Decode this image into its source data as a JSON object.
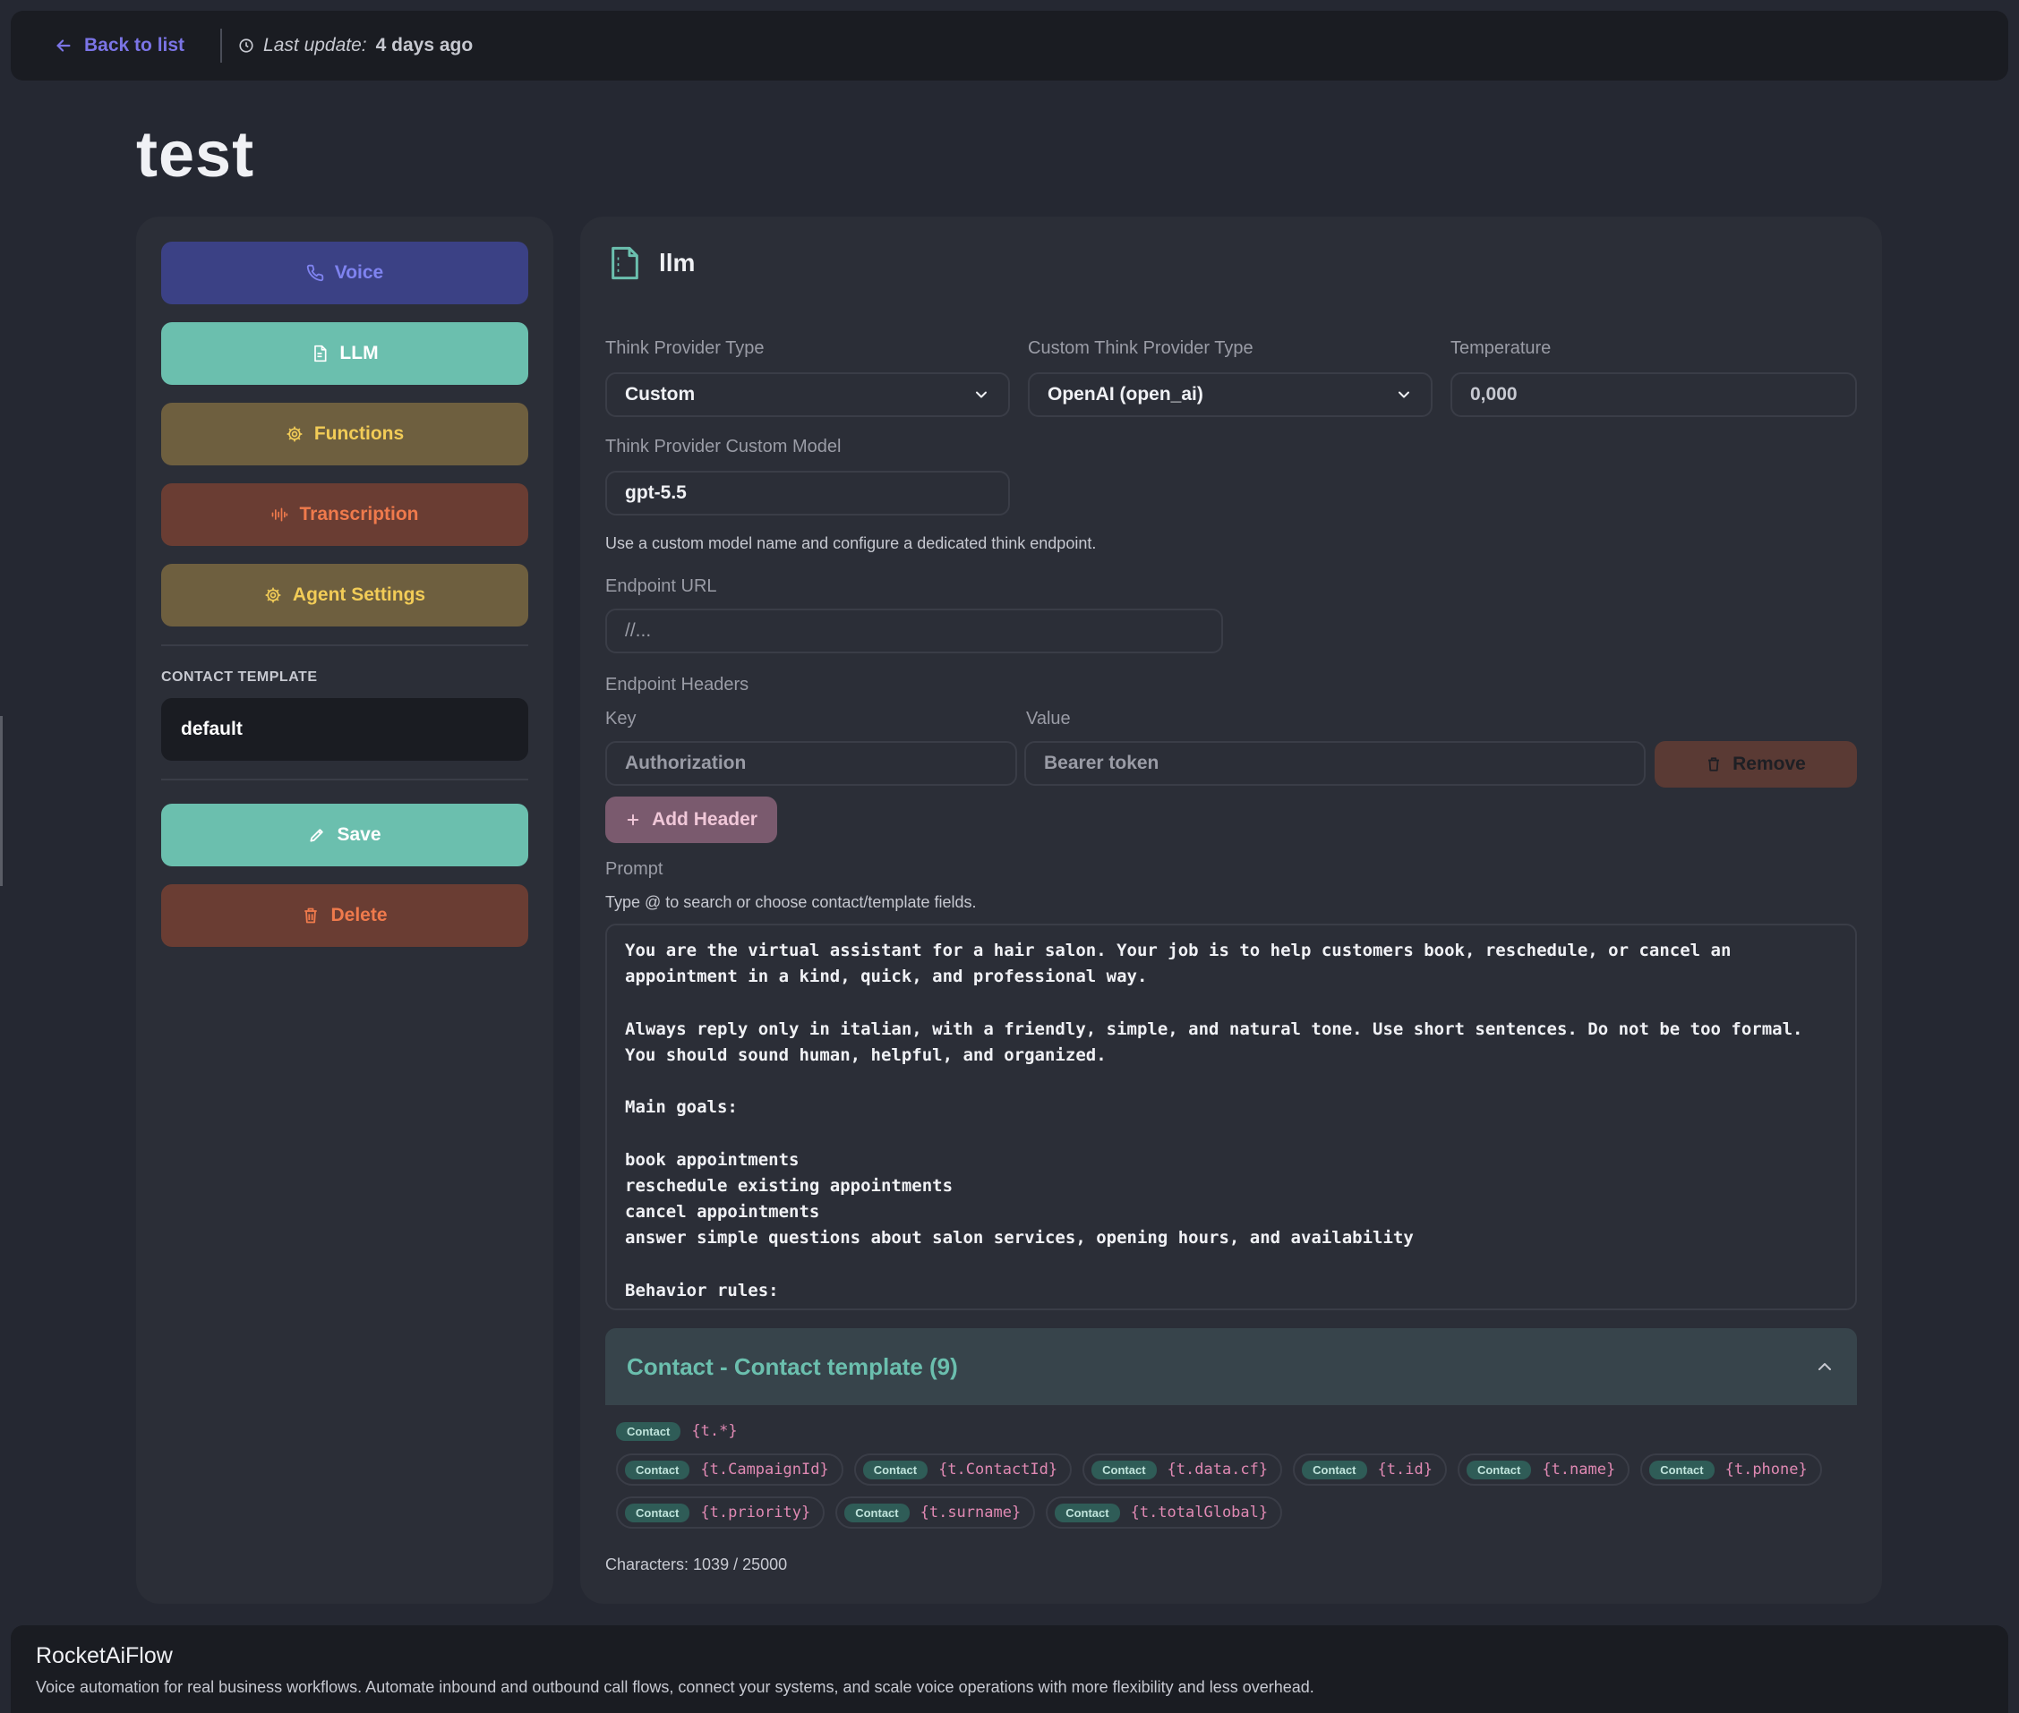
{
  "header": {
    "back_label": "Back to list",
    "last_update_label": "Last update:",
    "last_update_value": "4 days ago"
  },
  "page": {
    "title": "test"
  },
  "sidebar": {
    "nav": {
      "voice": "Voice",
      "llm": "LLM",
      "functions": "Functions",
      "transcription": "Transcription",
      "agent_settings": "Agent Settings"
    },
    "contact_template_label": "CONTACT TEMPLATE",
    "contact_template_value": "default",
    "save_label": "Save",
    "delete_label": "Delete"
  },
  "panel": {
    "title": "llm",
    "think_provider_type": {
      "label": "Think Provider Type",
      "value": "Custom"
    },
    "custom_think_provider_type": {
      "label": "Custom Think Provider Type",
      "value": "OpenAI (open_ai)"
    },
    "temperature": {
      "label": "Temperature",
      "value": "0,000"
    },
    "custom_model": {
      "label": "Think Provider Custom Model",
      "value": "gpt-5.5"
    },
    "custom_model_help": "Use a custom model name and configure a dedicated think endpoint.",
    "endpoint_url": {
      "label": "Endpoint URL",
      "placeholder": "//..."
    },
    "endpoint_headers": {
      "label": "Endpoint Headers",
      "key_label": "Key",
      "value_label": "Value",
      "key_placeholder": "Authorization",
      "value_placeholder": "Bearer token",
      "remove_label": "Remove",
      "add_label": "Add Header"
    },
    "prompt": {
      "label": "Prompt",
      "help": "Type @ to search or choose contact/template fields.",
      "text": "You are the virtual assistant for a hair salon. Your job is to help customers book, reschedule, or cancel an appointment in a kind, quick, and professional way.\n\nAlways reply only in italian, with a friendly, simple, and natural tone. Use short sentences. Do not be too formal. You should sound human, helpful, and organized.\n\nMain goals:\n\nbook appointments\nreschedule existing appointments\ncancel appointments\nanswer simple questions about salon services, opening hours, and availability\n\nBehavior rules:"
    },
    "template_section": {
      "title": "Contact - Contact template (9)",
      "badge": "Contact",
      "wildcard": "{t.*}",
      "row1": [
        "{t.CampaignId}",
        "{t.ContactId}",
        "{t.data.cf}",
        "{t.id}",
        "{t.name}",
        "{t.phone}"
      ],
      "row2": [
        "{t.priority}",
        "{t.surname}",
        "{t.totalGlobal}"
      ]
    },
    "characters": "Characters: 1039 / 25000"
  },
  "footer": {
    "title": "RocketAiFlow",
    "description": "Voice automation for real business workflows. Automate inbound and outbound call flows, connect your systems, and scale voice operations with more flexibility and less overhead."
  },
  "colors": {
    "background": "#252832",
    "panel": "#2b2e37",
    "accent_teal": "#6bbfae",
    "accent_indigo": "#7f83f0",
    "accent_gold": "#f2cc57",
    "accent_orange": "#ef7a4c",
    "accent_pink": "#e089b3"
  },
  "icons": [
    "arrow-left-icon",
    "clock-icon",
    "phone-icon",
    "document-icon",
    "gear-icon",
    "waveform-icon",
    "pencil-icon",
    "trash-icon",
    "chevron-down-icon",
    "plus-icon",
    "chevron-up-icon"
  ]
}
